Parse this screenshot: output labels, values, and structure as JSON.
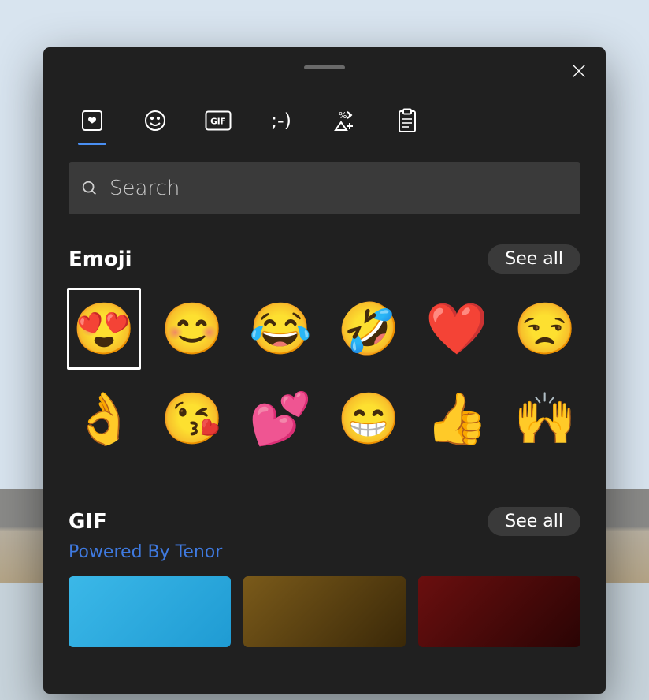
{
  "tabs": [
    {
      "id": "recents",
      "icon": "heart-square-icon",
      "active": true
    },
    {
      "id": "emoji",
      "icon": "smiley-icon",
      "active": false
    },
    {
      "id": "gif",
      "icon": "gif-icon",
      "active": false
    },
    {
      "id": "kaomoji",
      "icon": "kaomoji-icon",
      "active": false
    },
    {
      "id": "symbols",
      "icon": "symbols-icon",
      "active": false
    },
    {
      "id": "clipboard",
      "icon": "clipboard-icon",
      "active": false
    }
  ],
  "search": {
    "placeholder": "Search",
    "value": ""
  },
  "sections": {
    "emoji": {
      "title": "Emoji",
      "see_all": "See all",
      "items": [
        {
          "glyph": "😍",
          "name": "smiling-face-with-heart-eyes",
          "selected": true
        },
        {
          "glyph": "😊",
          "name": "smiling-face-with-smiling-eyes",
          "selected": false
        },
        {
          "glyph": "😂",
          "name": "face-with-tears-of-joy",
          "selected": false
        },
        {
          "glyph": "🤣",
          "name": "rolling-on-the-floor-laughing",
          "selected": false
        },
        {
          "glyph": "❤️",
          "name": "red-heart",
          "selected": false
        },
        {
          "glyph": "😒",
          "name": "unamused-face",
          "selected": false
        },
        {
          "glyph": "👌",
          "name": "ok-hand",
          "selected": false
        },
        {
          "glyph": "😘",
          "name": "face-blowing-a-kiss",
          "selected": false
        },
        {
          "glyph": "💕",
          "name": "two-hearts",
          "selected": false
        },
        {
          "glyph": "😁",
          "name": "beaming-face-with-smiling-eyes",
          "selected": false
        },
        {
          "glyph": "👍",
          "name": "thumbs-up",
          "selected": false
        },
        {
          "glyph": "🙌",
          "name": "raising-hands",
          "selected": false
        }
      ]
    },
    "gif": {
      "title": "GIF",
      "see_all": "See all",
      "powered_by": "Powered By Tenor",
      "thumbnails": [
        {
          "style": "a"
        },
        {
          "style": "b"
        },
        {
          "style": "c"
        }
      ]
    }
  }
}
